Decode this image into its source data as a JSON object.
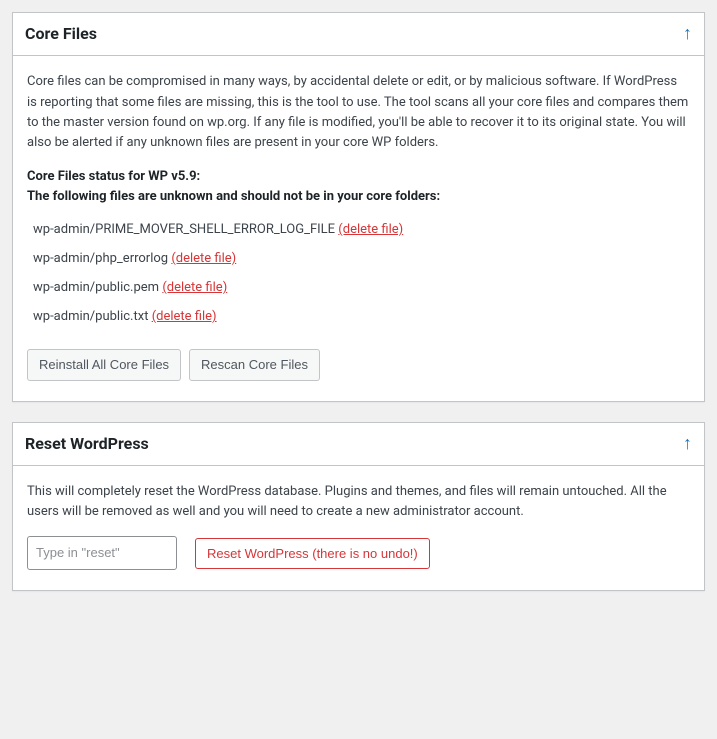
{
  "coreFiles": {
    "title": "Core Files",
    "description": "Core files can be compromised in many ways, by accidental delete or edit, or by malicious software. If WordPress is reporting that some files are missing, this is the tool to use. The tool scans all your core files and compares them to the master version found on wp.org. If any file is modified, you'll be able to recover it to its original state.\nYou will also be alerted if any unknown files are present in your core WP folders.",
    "statusLine1": "Core Files status for WP v5.9:",
    "statusLine2": "The following files are unknown and should not be in your core folders:",
    "files": [
      {
        "path": "wp-admin/PRIME_MOVER_SHELL_ERROR_LOG_FILE",
        "action": "(delete file)"
      },
      {
        "path": "wp-admin/php_errorlog",
        "action": "(delete file)"
      },
      {
        "path": "wp-admin/public.pem",
        "action": "(delete file)"
      },
      {
        "path": "wp-admin/public.txt",
        "action": "(delete file)"
      }
    ],
    "reinstallBtn": "Reinstall All Core Files",
    "rescanBtn": "Rescan Core Files"
  },
  "resetWp": {
    "title": "Reset WordPress",
    "description": "This will completely reset the WordPress database. Plugins and themes, and files will remain untouched. All the users will be removed as well and you will need to create a new administrator account.",
    "placeholder": "Type in \"reset\"",
    "resetBtn": "Reset WordPress (there is no undo!)"
  }
}
